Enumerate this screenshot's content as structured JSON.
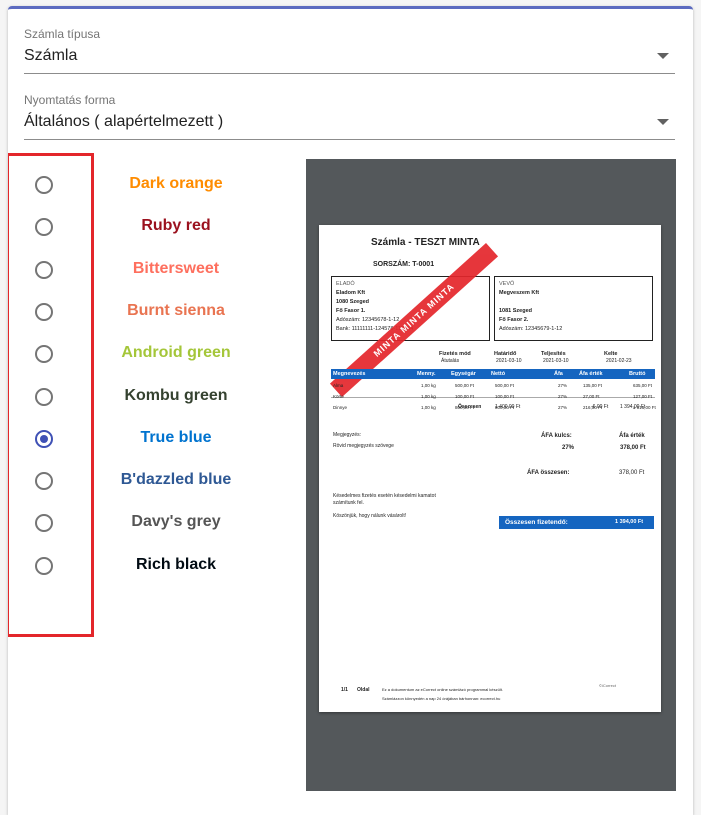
{
  "invoice_type": {
    "label": "Számla típusa",
    "value": "Számla"
  },
  "print_form": {
    "label": "Nyomtatás forma",
    "value": "Általános ( alapértelmezett )"
  },
  "colors": [
    {
      "name": "Dark orange",
      "color": "#ff8c00",
      "selected": false
    },
    {
      "name": "Ruby red",
      "color": "#9b111e",
      "selected": false
    },
    {
      "name": "Bittersweet",
      "color": "#fe6f5e",
      "selected": false
    },
    {
      "name": "Burnt sienna",
      "color": "#e97451",
      "selected": false
    },
    {
      "name": "Android green",
      "color": "#a4c639",
      "selected": false
    },
    {
      "name": "Kombu green",
      "color": "#354230",
      "selected": false
    },
    {
      "name": "True blue",
      "color": "#0073cf",
      "selected": true
    },
    {
      "name": "B'dazzled blue",
      "color": "#2e5894",
      "selected": false
    },
    {
      "name": "Davy's grey",
      "color": "#555555",
      "selected": false
    },
    {
      "name": "Rich black",
      "color": "#010b13",
      "selected": false
    }
  ],
  "preview": {
    "title": "Számla - TESZT MINTA",
    "serial_label": "SORSZÁM:",
    "serial_value": "T-0001",
    "watermark": "MINTA MINTA MINTA",
    "seller": {
      "label": "ELADÓ",
      "name": "Eladom Kft",
      "city": "1080 Szeged",
      "street": "Fő Fasor 1.",
      "tax": "Adószám: 12345678-1-12",
      "bank": "Bank: 11111111-124578-112354"
    },
    "buyer": {
      "label": "VEVŐ",
      "name": "Megveszem Kft",
      "city": "1081 Szeged",
      "street": "Fő Fasor 2.",
      "tax": "Adószám: 12345679-1-12"
    },
    "meta": [
      {
        "label": "Fizetés mód",
        "value": "Átutalás"
      },
      {
        "label": "Határidő",
        "value": "2021-03-10"
      },
      {
        "label": "Teljesítés",
        "value": "2021-03-10"
      },
      {
        "label": "Kelte",
        "value": "2021-02-23"
      }
    ],
    "columns": [
      "Megnevezés",
      "Menny.",
      "Egységár",
      "Nettó",
      "Áfa",
      "Áfa érték",
      "Bruttó"
    ],
    "rows": [
      [
        "Alma",
        "1,00 kg",
        "500,00 Ft",
        "500,00 Ft",
        "27%",
        "135,00 Ft",
        "635,00 Ft"
      ],
      [
        "Körte",
        "1,00 kg",
        "100,00 Ft",
        "100,00 Ft",
        "27%",
        "27,00 Ft",
        "127,00 Ft"
      ],
      [
        "Dinnye",
        "1,00 kg",
        "800,00 Ft",
        "800,00 Ft",
        "27%",
        "216,00 Ft",
        "1 016,00 Ft"
      ]
    ],
    "sum_label": "Összesen",
    "sum_net": "1 400,00 Ft",
    "sum_vat": "-6,00 Ft",
    "sum_gross": "1 394,00 Ft",
    "note_label": "Megjegyzés:",
    "note_text": "Rövid megjegyzés szövege",
    "vat_key_label": "ÁFA kulcs:",
    "vat_value_label": "Áfa érték",
    "vat_key": "27%",
    "vat_value": "378,00 Ft",
    "vat_total_label": "ÁFA összesen:",
    "vat_total": "378,00 Ft",
    "late_text_1": "Késedelmes fizetés esetén késedelmi kamatot",
    "late_text_2": "számítunk fel.",
    "thanks": "Köszönjük, hogy nálunk vásárolt!",
    "total_label": "Összesen fizetendő:",
    "total_value": "1 394,00 Ft",
    "page": "1/1",
    "page_label": "Oldal",
    "footer_1": "Ez a dokumentum az eCorrect online számlázó programmal készült.",
    "footer_2": "Számlázzon könnyedén a nap 24 órájában bárhonnan: ecorrect.hu",
    "logo": "©iCorrect"
  }
}
